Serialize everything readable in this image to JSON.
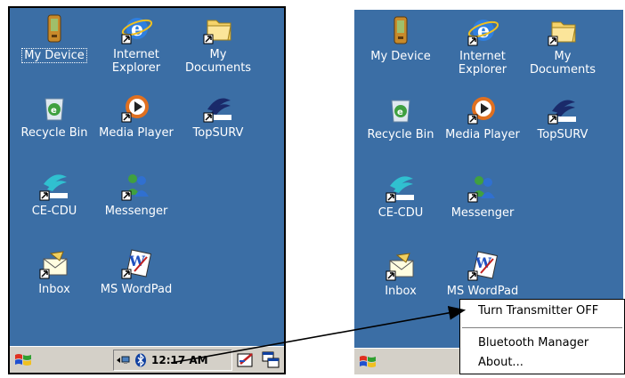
{
  "left_screen": {
    "icons": [
      {
        "label": "My Device",
        "icon": "pda-icon"
      },
      {
        "label": "Internet\nExplorer",
        "icon": "internet-explorer-icon"
      },
      {
        "label": "My\nDocuments",
        "icon": "folder-icon"
      },
      {
        "label": "Recycle Bin",
        "icon": "recycle-bin-icon"
      },
      {
        "label": "Media Player",
        "icon": "media-player-icon"
      },
      {
        "label": "TopSURV",
        "icon": "topsurv-icon"
      },
      {
        "label": "CE-CDU",
        "icon": "ce-cdu-icon"
      },
      {
        "label": "Messenger",
        "icon": "messenger-icon"
      },
      {
        "label": "Inbox",
        "icon": "inbox-icon"
      },
      {
        "label": "MS WordPad",
        "icon": "wordpad-icon"
      }
    ],
    "taskbar": {
      "clock": "12:17 AM",
      "tray_icons": [
        "network-icon",
        "bluetooth-icon"
      ],
      "buttons": [
        "input-panel-icon",
        "switch-windows-icon"
      ]
    }
  },
  "right_screen": {
    "icons": [
      {
        "label": "My Device",
        "icon": "pda-icon"
      },
      {
        "label": "Internet\nExplorer",
        "icon": "internet-explorer-icon"
      },
      {
        "label": "My\nDocuments",
        "icon": "folder-icon"
      },
      {
        "label": "Recycle Bin",
        "icon": "recycle-bin-icon"
      },
      {
        "label": "Media Player",
        "icon": "media-player-icon"
      },
      {
        "label": "TopSURV",
        "icon": "topsurv-icon"
      },
      {
        "label": "CE-CDU",
        "icon": "ce-cdu-icon"
      },
      {
        "label": "Messenger",
        "icon": "messenger-icon"
      },
      {
        "label": "Inbox",
        "icon": "inbox-icon"
      },
      {
        "label": "MS WordPad",
        "icon": "wordpad-icon"
      }
    ]
  },
  "context_menu": {
    "items": [
      "Turn Transmitter OFF",
      "Bluetooth Manager",
      "About..."
    ]
  },
  "colors": {
    "desktop": "#3b6ea5",
    "taskbar": "#d4d0c8",
    "menu": "#ffffff"
  }
}
